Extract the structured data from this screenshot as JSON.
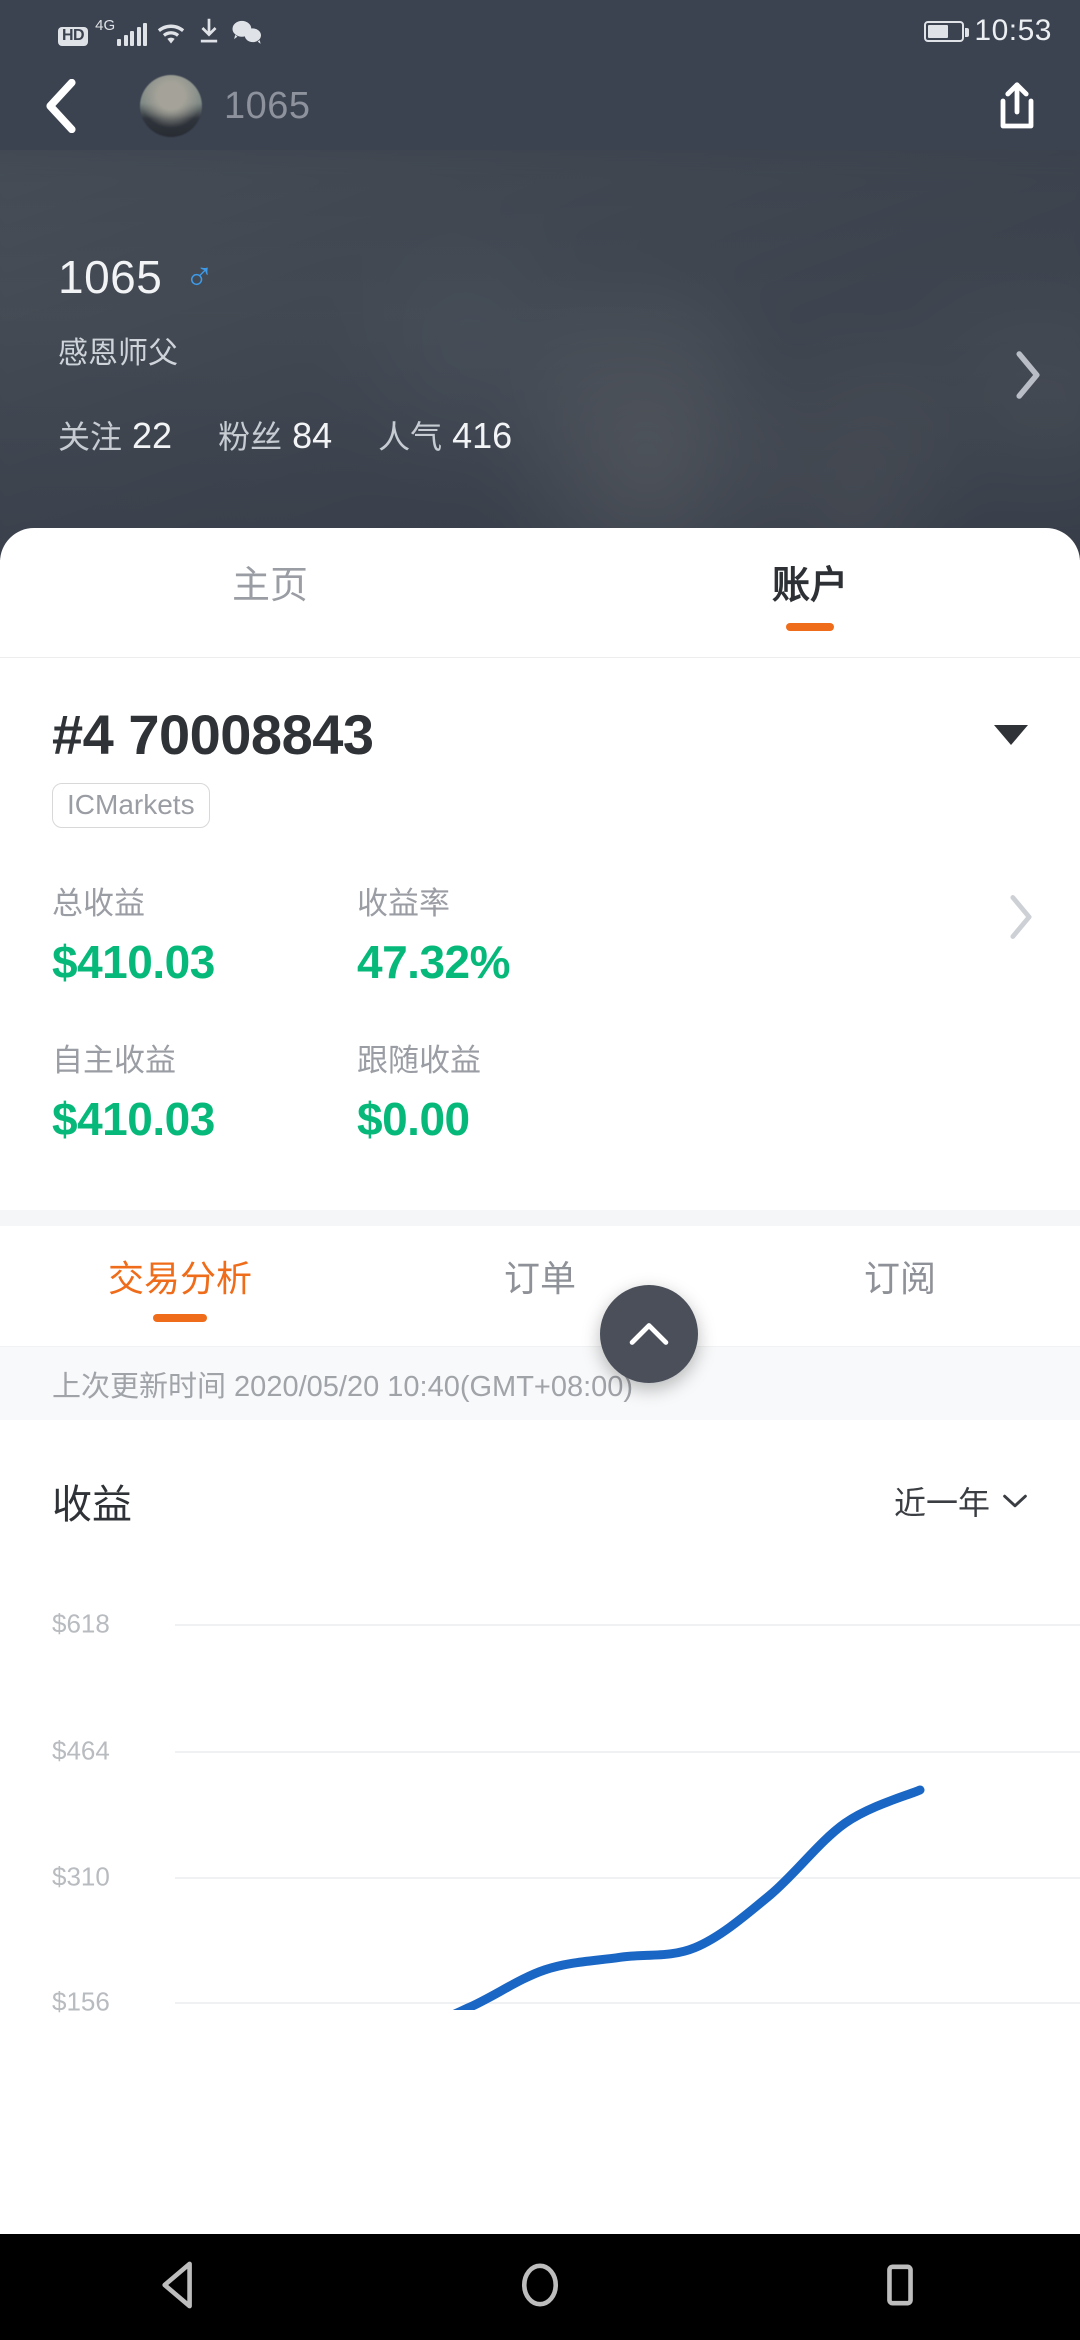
{
  "status_bar": {
    "hd_label": "HD",
    "network_label": "4G",
    "icons": [
      "hd-icon",
      "signal-bars-icon",
      "wifi-icon",
      "download-icon",
      "wechat-icon",
      "battery-icon"
    ],
    "time": "10:53"
  },
  "nav_bar": {
    "back_icon": "back-chevron-icon",
    "title": "1065",
    "share_icon": "share-icon"
  },
  "profile": {
    "name": "1065",
    "gender_symbol": "♂",
    "bio": "感恩师父",
    "stats": [
      {
        "label": "关注",
        "value": "22"
      },
      {
        "label": "粉丝",
        "value": "84"
      },
      {
        "label": "人气",
        "value": "416"
      }
    ],
    "chevron_icon": "chevron-right-icon"
  },
  "main_tabs": [
    {
      "label": "主页",
      "active": false
    },
    {
      "label": "账户",
      "active": true
    }
  ],
  "account": {
    "number": "#4 70008843",
    "broker": "ICMarkets",
    "dropdown_icon": "caret-down-icon",
    "detail_chevron_icon": "chevron-right-icon",
    "metrics": [
      {
        "label": "总收益",
        "value": "$410.03"
      },
      {
        "label": "收益率",
        "value": "47.32%"
      },
      {
        "label": "自主收益",
        "value": "$410.03"
      },
      {
        "label": "跟随收益",
        "value": "$0.00"
      }
    ]
  },
  "sub_tabs": [
    {
      "label": "交易分析",
      "active": true
    },
    {
      "label": "订单",
      "active": false
    },
    {
      "label": "订阅",
      "active": false
    }
  ],
  "update_bar": {
    "text": "上次更新时间 2020/05/20 10:40(GMT+08:00)"
  },
  "chart_section": {
    "title": "收益",
    "period": "近一年",
    "period_icon": "chevron-down-icon"
  },
  "chart_data": {
    "type": "line",
    "title": "收益",
    "xlabel": "",
    "ylabel": "",
    "ylim": [
      2,
      618
    ],
    "ytick_labels": [
      "$618",
      "$464",
      "$310",
      "$156"
    ],
    "ytick_values": [
      618,
      464,
      310,
      156
    ],
    "grid": true,
    "legend": "none",
    "line_color": "#1a66c4",
    "series": [
      {
        "name": "收益",
        "x": [
          0,
          1,
          2,
          3,
          4,
          5,
          6,
          7,
          8
        ],
        "values": [
          2,
          20,
          64,
          118,
          136,
          150,
          226,
          330,
          378
        ]
      }
    ]
  },
  "fab": {
    "icon": "chevron-up-icon",
    "color": "#4a4f5a"
  },
  "android_nav": {
    "items": [
      {
        "icon": "back-triangle-icon",
        "name": "back"
      },
      {
        "icon": "home-circle-icon",
        "name": "home"
      },
      {
        "icon": "recents-square-icon",
        "name": "recents"
      }
    ]
  },
  "colors": {
    "accent_orange": "#ef6c1a",
    "profit_green": "#06b97a",
    "chart_blue": "#1a66c4",
    "header_dark": "#3b4250"
  }
}
